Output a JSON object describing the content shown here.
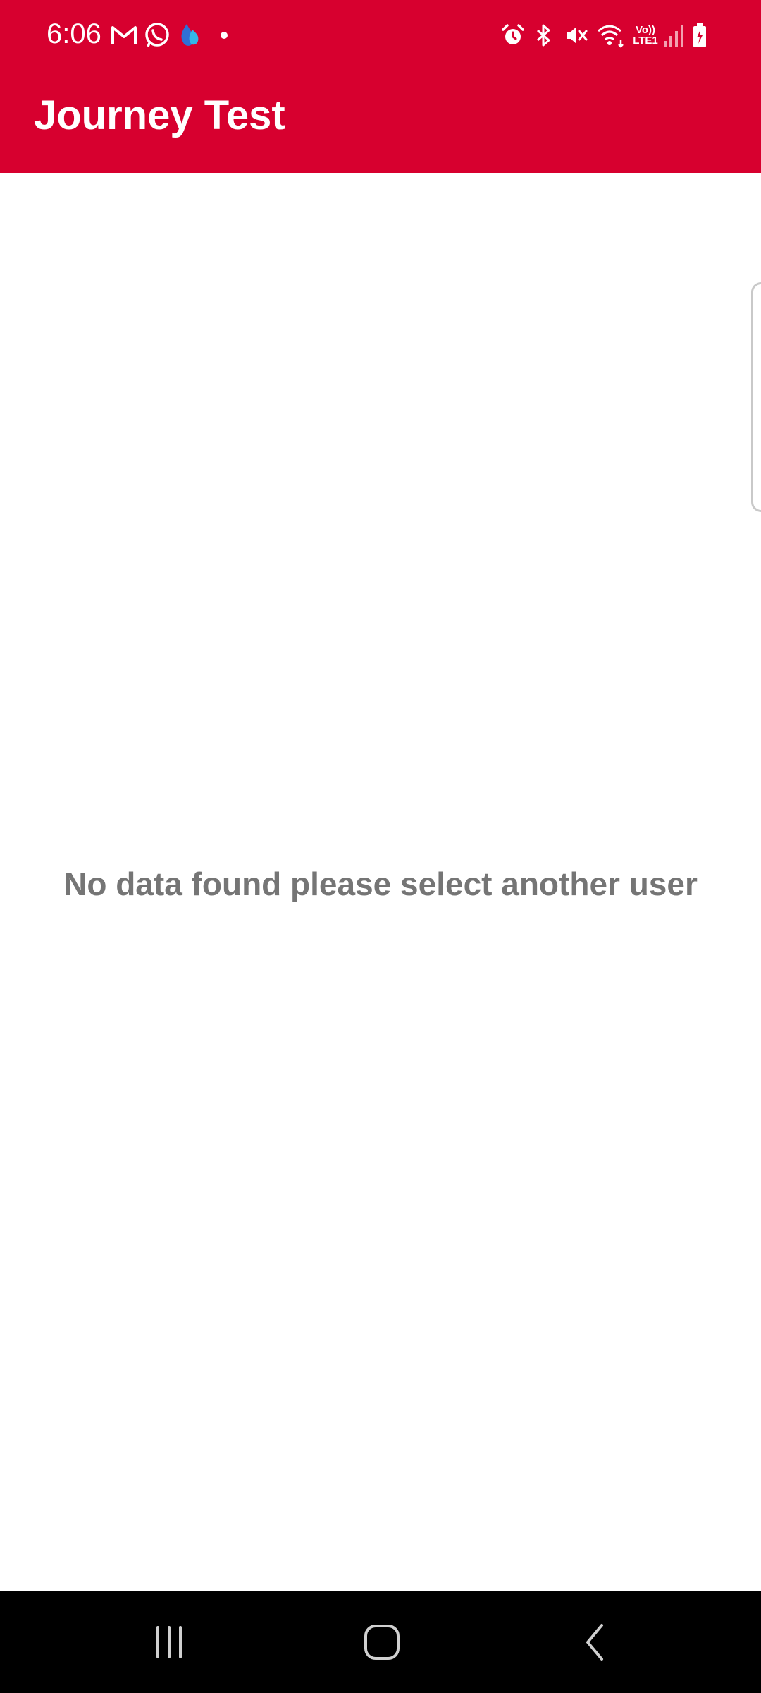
{
  "status_bar": {
    "time": "6:06",
    "left_icons": [
      "gmail-icon",
      "whatsapp-icon",
      "drop-app-icon",
      "notification-dot-icon"
    ],
    "right_icons": [
      "alarm-icon",
      "bluetooth-icon",
      "mute-icon",
      "wifi-icon",
      "volte-icon",
      "signal-icon",
      "battery-charging-icon"
    ],
    "volte_label": "Vo)) LTE1"
  },
  "app_bar": {
    "title": "Journey Test",
    "color": "#d7002f"
  },
  "content": {
    "empty_message": "No data found please select another user",
    "message_color": "#757575"
  },
  "nav_bar": {
    "buttons": [
      "recents-icon",
      "home-icon",
      "back-icon"
    ]
  }
}
